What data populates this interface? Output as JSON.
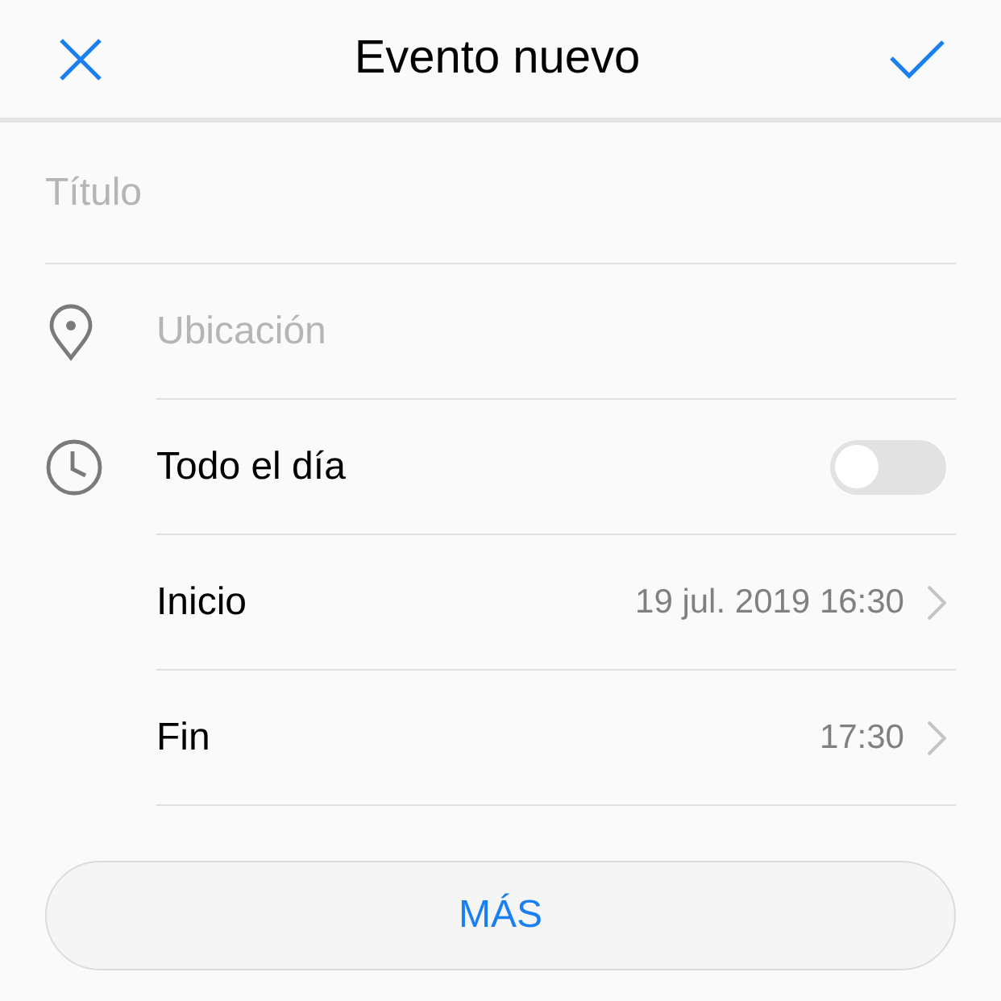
{
  "header": {
    "title": "Evento nuevo"
  },
  "title_field": {
    "placeholder": "Título"
  },
  "location_field": {
    "placeholder": "Ubicación"
  },
  "all_day": {
    "label": "Todo el día",
    "on": false
  },
  "rows": [
    {
      "label": "Inicio",
      "value": "19 jul. 2019 16:30"
    },
    {
      "label": "Fin",
      "value": "17:30"
    }
  ],
  "more_button": {
    "label": "MÁS"
  }
}
